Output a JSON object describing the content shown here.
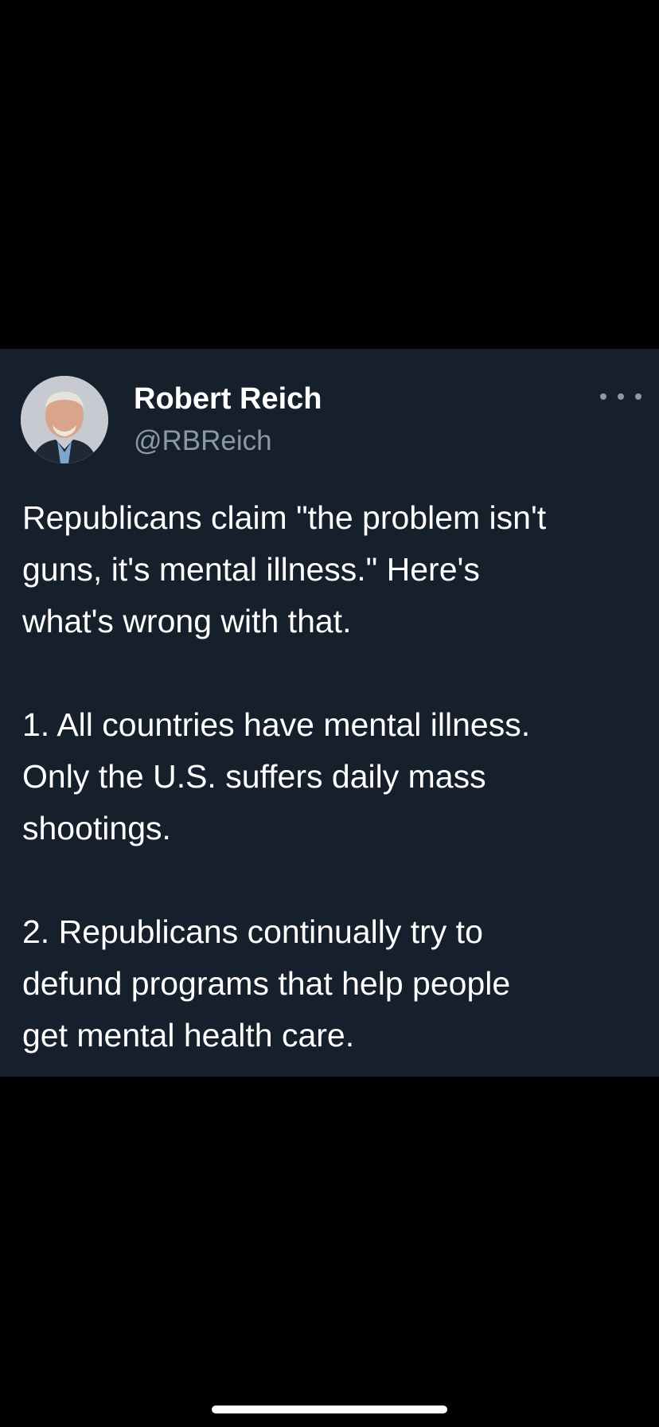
{
  "tweet": {
    "author": {
      "display_name": "Robert Reich",
      "handle": "@RBReich",
      "avatar_icon": "profile-photo"
    },
    "more_icon": "more-horizontal-icon",
    "paragraphs": [
      "Republicans claim \"the problem isn't\nguns, it's mental illness.\" Here's\nwhat's wrong with that.",
      "1. All countries have mental illness.\nOnly the U.S. suffers daily mass\nshootings.",
      "2. Republicans continually try to\ndefund programs that help people\nget mental health care."
    ]
  },
  "colors": {
    "screen_background": "#000000",
    "card_background": "#161f2c",
    "primary_text": "#ffffff",
    "secondary_text": "#8b98a5"
  }
}
